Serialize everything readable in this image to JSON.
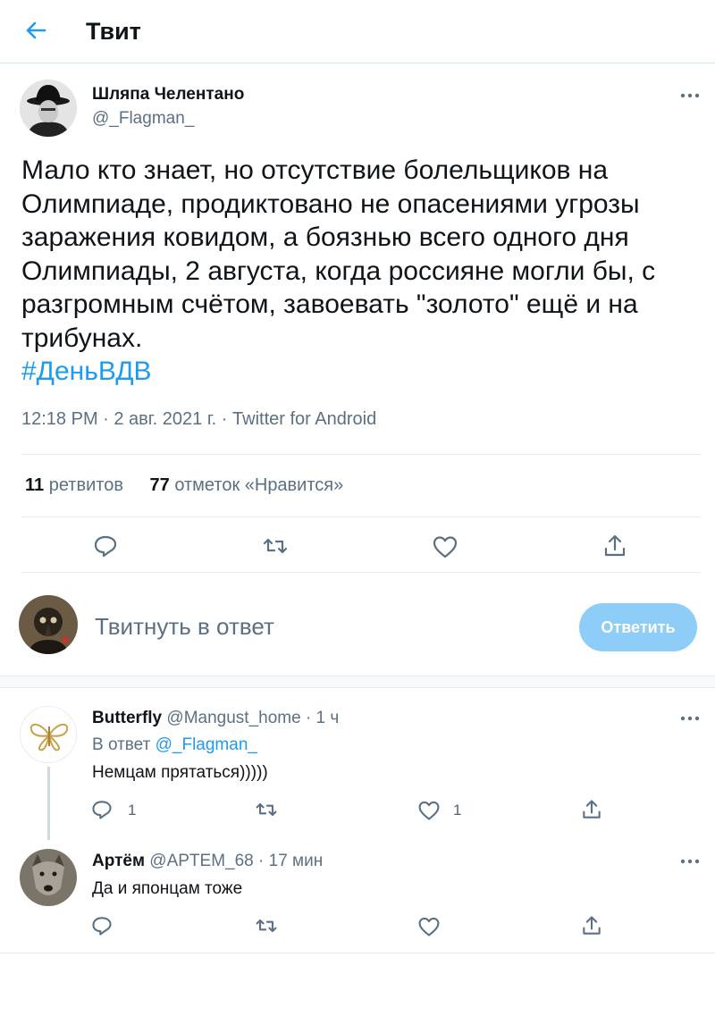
{
  "header": {
    "title": "Твит"
  },
  "tweet": {
    "author_name": "Шляпа Челентано",
    "author_handle": "@_Flagman_",
    "text": "Мало кто знает, но отсутствие болельщиков на Олимпиаде, продиктовано не опасениями угрозы заражения ковидом, а боязнью всего одного дня Олимпиады, 2 августа, когда россияне могли бы, с разгромным счётом, завоевать \"золото\" ещё и на трибунах.",
    "hashtag": "#ДеньВДВ",
    "meta": "12:18 PM · 2 авг. 2021 г. · Twitter for Android",
    "retweets_count": "11",
    "retweets_label": "ретвитов",
    "likes_count": "77",
    "likes_label": "отметок «Нравится»"
  },
  "composer": {
    "placeholder": "Твитнуть в ответ",
    "button_label": "Ответить"
  },
  "replies": [
    {
      "name": "Butterfly",
      "handle": "@Mangust_home",
      "time": "· 1 ч",
      "reply_to_prefix": "В ответ",
      "reply_to_handle": "@_Flagman_",
      "text": "Немцам прятаться)))))",
      "reply_count": "1",
      "like_count": "1"
    },
    {
      "name": "Артём",
      "handle": "@APTEM_68",
      "time": "· 17 мин",
      "text": "Да и японцам тоже"
    }
  ],
  "icons": {
    "back": "arrow-left-icon",
    "more": "more-icon",
    "reply": "reply-icon",
    "retweet": "retweet-icon",
    "like": "heart-icon",
    "share": "share-icon"
  },
  "colors": {
    "accent": "#1d9bf0",
    "button_disabled": "#8ecdf7",
    "muted": "#5b7083"
  }
}
